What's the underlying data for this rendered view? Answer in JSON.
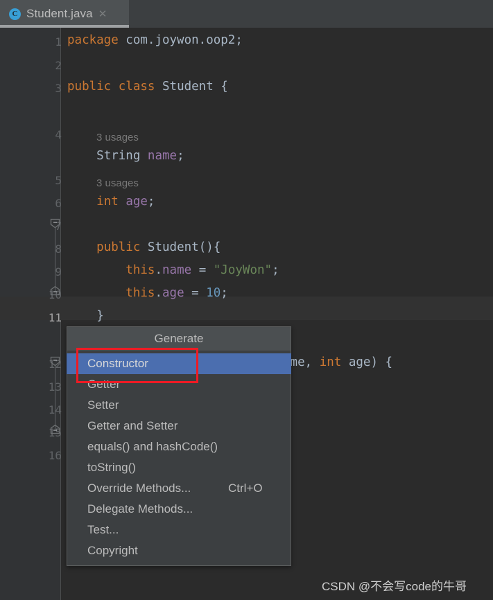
{
  "window": {
    "background_color": "#2b2b2b",
    "gutter_color": "#313335",
    "accent_color": "#4b6eaf",
    "annotation_color": "#ee1b24"
  },
  "tab": {
    "icon": "java-class-icon",
    "icon_letter": "C",
    "title": "Student.java",
    "close_label": "✕"
  },
  "editor": {
    "line_numbers": [
      "1",
      "2",
      "3",
      "4",
      "5",
      "6",
      "7",
      "8",
      "9",
      "10",
      "11",
      "12",
      "13",
      "14",
      "15",
      "16"
    ],
    "current_line": "11",
    "inlay_hints": [
      {
        "text": "3 usages",
        "after_line": "3"
      },
      {
        "text": "3 usages",
        "after_line": "4"
      }
    ],
    "lines": [
      {
        "n": "1",
        "tokens": [
          {
            "t": "package",
            "c": "kw"
          },
          {
            "t": " com.joywon.oop2;",
            "c": "pln"
          }
        ]
      },
      {
        "n": "2",
        "tokens": []
      },
      {
        "n": "3",
        "tokens": [
          {
            "t": "public",
            "c": "kw"
          },
          {
            "t": " ",
            "c": "pln"
          },
          {
            "t": "class",
            "c": "kw"
          },
          {
            "t": " ",
            "c": "pln"
          },
          {
            "t": "Student",
            "c": "cls"
          },
          {
            "t": " {",
            "c": "pln"
          }
        ]
      },
      {
        "n": "4",
        "tokens": [
          {
            "t": "    ",
            "c": "pln"
          },
          {
            "t": "String",
            "c": "cls"
          },
          {
            "t": " ",
            "c": "pln"
          },
          {
            "t": "name",
            "c": "fld"
          },
          {
            "t": ";",
            "c": "pln"
          }
        ]
      },
      {
        "n": "5",
        "tokens": [
          {
            "t": "    ",
            "c": "pln"
          },
          {
            "t": "int",
            "c": "kw"
          },
          {
            "t": " ",
            "c": "pln"
          },
          {
            "t": "age",
            "c": "fld"
          },
          {
            "t": ";",
            "c": "pln"
          }
        ]
      },
      {
        "n": "6",
        "tokens": []
      },
      {
        "n": "7",
        "tokens": [
          {
            "t": "    ",
            "c": "pln"
          },
          {
            "t": "public",
            "c": "kw"
          },
          {
            "t": " ",
            "c": "pln"
          },
          {
            "t": "Student",
            "c": "cls"
          },
          {
            "t": "(){",
            "c": "pln"
          }
        ]
      },
      {
        "n": "8",
        "tokens": [
          {
            "t": "        ",
            "c": "pln"
          },
          {
            "t": "this",
            "c": "kw"
          },
          {
            "t": ".",
            "c": "pln"
          },
          {
            "t": "name",
            "c": "fld"
          },
          {
            "t": " = ",
            "c": "pln"
          },
          {
            "t": "\"JoyWon\"",
            "c": "str"
          },
          {
            "t": ";",
            "c": "pln"
          }
        ]
      },
      {
        "n": "9",
        "tokens": [
          {
            "t": "        ",
            "c": "pln"
          },
          {
            "t": "this",
            "c": "kw"
          },
          {
            "t": ".",
            "c": "pln"
          },
          {
            "t": "age",
            "c": "fld"
          },
          {
            "t": " = ",
            "c": "pln"
          },
          {
            "t": "10",
            "c": "num"
          },
          {
            "t": ";",
            "c": "pln"
          }
        ]
      },
      {
        "n": "10",
        "tokens": [
          {
            "t": "    }",
            "c": "pln"
          }
        ]
      },
      {
        "n": "11",
        "tokens": []
      },
      {
        "n": "12",
        "tokens": [
          {
            "t": "ame",
            "c": "pln"
          },
          {
            "t": ", ",
            "c": "pln"
          },
          {
            "t": "int",
            "c": "kw"
          },
          {
            "t": " ",
            "c": "pln"
          },
          {
            "t": "age",
            "c": "pln"
          },
          {
            "t": ") {",
            "c": "pln"
          }
        ]
      }
    ]
  },
  "popup": {
    "title": "Generate",
    "items": [
      {
        "label": "Constructor",
        "shortcut": "",
        "selected": true
      },
      {
        "label": "Getter",
        "shortcut": "",
        "selected": false
      },
      {
        "label": "Setter",
        "shortcut": "",
        "selected": false
      },
      {
        "label": "Getter and Setter",
        "shortcut": "",
        "selected": false
      },
      {
        "label": "equals() and hashCode()",
        "shortcut": "",
        "selected": false
      },
      {
        "label": "toString()",
        "shortcut": "",
        "selected": false
      },
      {
        "label": "Override Methods...",
        "shortcut": "Ctrl+O",
        "selected": false
      },
      {
        "label": "Delegate Methods...",
        "shortcut": "",
        "selected": false
      },
      {
        "label": "Test...",
        "shortcut": "",
        "selected": false
      },
      {
        "label": "Copyright",
        "shortcut": "",
        "selected": false
      }
    ]
  },
  "watermark": {
    "text": "CSDN @不会写code的牛哥"
  }
}
